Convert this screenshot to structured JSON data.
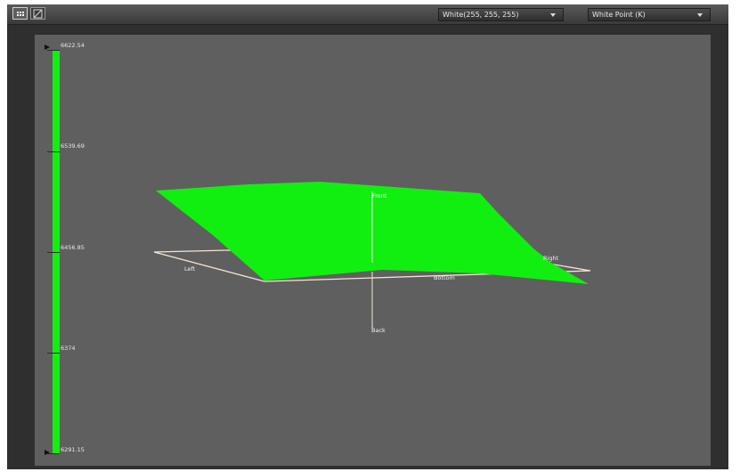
{
  "toolbar": {
    "buttons": [
      {
        "icon": "grid-icon",
        "active": true
      },
      {
        "icon": "curve-graph-icon",
        "active": false
      }
    ],
    "color_select": {
      "value": "White(255, 255, 255)"
    },
    "metric_select": {
      "value": "White Point (K)"
    }
  },
  "legend": {
    "color": "#11ef11",
    "labels": [
      "6622.54",
      "6539.69",
      "6456.85",
      "6374",
      "6291.15"
    ]
  },
  "plot": {
    "surface_color": "#11ef11",
    "box_color": "#f4e4d4",
    "axis_labels": {
      "front": "Front",
      "back": "Back",
      "left": "Left",
      "right": "Right",
      "bottom": "Bottom"
    }
  }
}
